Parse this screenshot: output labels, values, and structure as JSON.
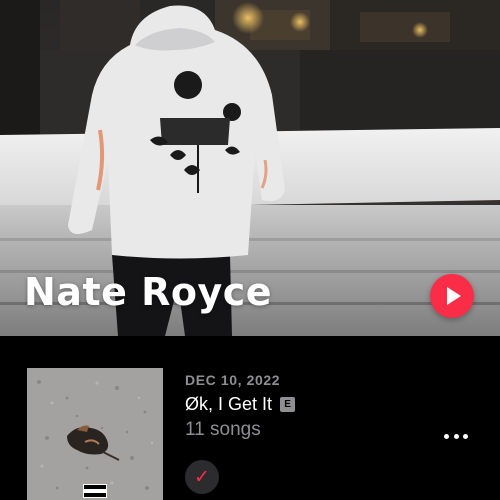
{
  "artist": {
    "name": "Nate Royce",
    "play_icon": "play-icon"
  },
  "release": {
    "date": "DEC 10, 2022",
    "title": "Øk, I Get It",
    "explicit_badge": "E",
    "song_count": "11 songs",
    "cover_label": "PARENTAL ADVISORY",
    "more_icon": "ellipsis-icon",
    "added_icon": "checkmark-icon"
  },
  "colors": {
    "accent": "#fa2d48",
    "background": "#000000",
    "secondary_text": "#8e8e93"
  }
}
